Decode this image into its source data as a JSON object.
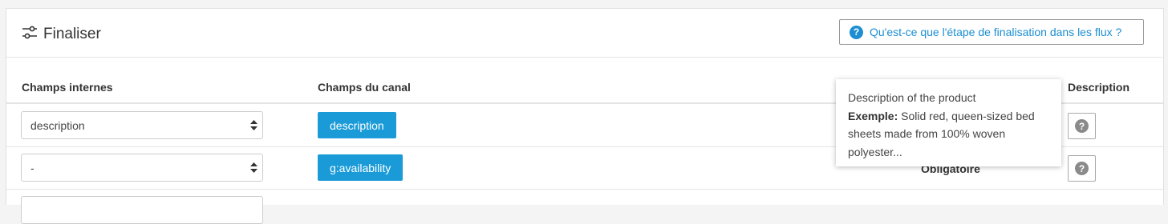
{
  "header": {
    "title": "Finaliser",
    "help_link": "Qu'est-ce que l'étape de finalisation dans les flux ?",
    "help_icon_glyph": "?"
  },
  "columns": {
    "internal": "Champs internes",
    "channel": "Champs du canal",
    "description": "Description"
  },
  "rows": [
    {
      "internal_value": "description",
      "channel_field": "description",
      "status": "",
      "help_glyph": "?"
    },
    {
      "internal_value": "-",
      "channel_field": "g:availability",
      "status": "Obligatoire",
      "help_glyph": "?"
    }
  ],
  "tooltip": {
    "line1": "Description of the product",
    "example_label": "Exemple:",
    "example_text": " Solid red, queen-sized bed sheets made from 100% woven polyester..."
  },
  "colors": {
    "accent": "#1c8ed1",
    "tag_bg": "#1a9bd7"
  },
  "icons": {
    "settings": "sliders-icon",
    "help": "question-circle-icon",
    "select": "sort-arrows-icon"
  }
}
